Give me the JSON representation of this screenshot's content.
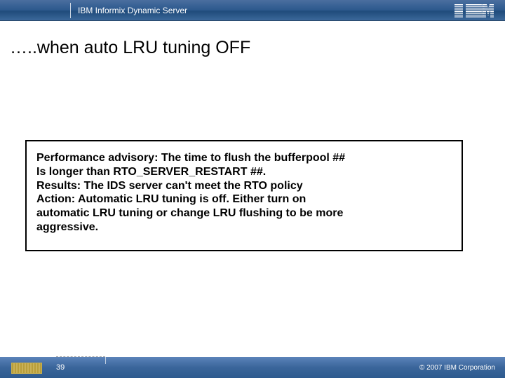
{
  "header": {
    "product_title": "IBM Informix Dynamic Server",
    "logo_label": "IBM"
  },
  "slide": {
    "title": "…..when auto LRU tuning OFF"
  },
  "advisory": {
    "line1": "Performance advisory: The time to flush the bufferpool ##",
    "line2": "Is longer than RTO_SERVER_RESTART ##.",
    "line3": "Results: The IDS server can't meet the RTO policy",
    "line4": "Action: Automatic LRU tuning is off. Either turn on",
    "line5": "automatic LRU tuning or change LRU flushing to be more",
    "line6": "aggressive."
  },
  "footer": {
    "page_number": "39",
    "copyright": "© 2007 IBM Corporation"
  }
}
